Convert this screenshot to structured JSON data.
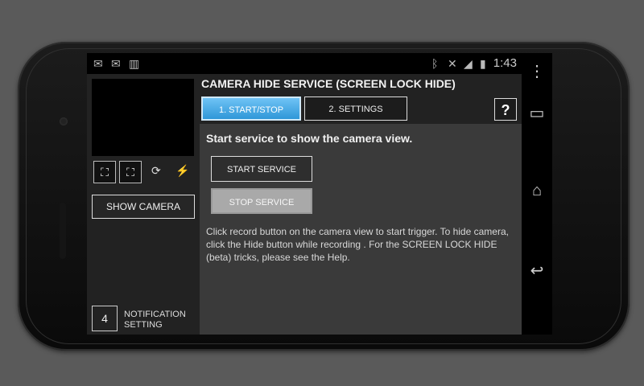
{
  "status_bar": {
    "left_icons": [
      "mail-icon",
      "mail-icon",
      "barcode-icon"
    ],
    "right_icons": [
      "bluetooth-icon",
      "vibrate-mute-icon",
      "signal-icon",
      "battery-icon"
    ],
    "time": "1:43"
  },
  "app": {
    "title": "CAMERA HIDE SERVICE (SCREEN LOCK HIDE)",
    "tabs": [
      {
        "label": "1. START/STOP",
        "active": true
      },
      {
        "label": "2. SETTINGS",
        "active": false
      }
    ],
    "help_label": "?"
  },
  "left_panel": {
    "show_camera_label": "SHOW CAMERA",
    "notification_label_line1": "NOTIFICATION",
    "notification_label_line2": "SETTING",
    "notification_icon_badge": "4"
  },
  "content": {
    "heading": "Start service to show the camera view.",
    "start_label": "START SERVICE",
    "stop_label": "STOP SERVICE",
    "help_text": "Click record button on the camera view to start trigger. To hide camera, click the Hide button while recording . For the SCREEN LOCK HIDE (beta) tricks, please see the Help."
  },
  "nav_bar": {
    "icons": [
      "overflow-menu-icon",
      "recent-apps-icon",
      "home-icon",
      "back-icon"
    ]
  },
  "colors": {
    "accent": "#2f97d8",
    "background": "#3a3a3a"
  }
}
